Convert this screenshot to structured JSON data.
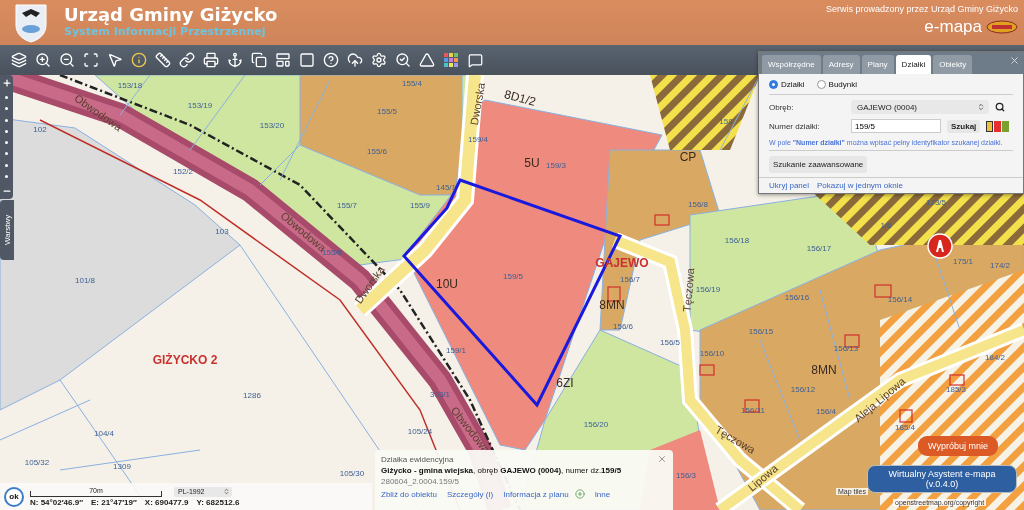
{
  "header": {
    "title": "Urząd Gminy Giżycko",
    "subtitle": "System Informacji Przestrzennej",
    "operator": "Serwis prowadzony przez Urząd Gminy Giżycko",
    "brand": "e-mapa"
  },
  "side_controls": {
    "layers_tab": "Warstwy"
  },
  "search_panel": {
    "tabs": [
      {
        "label": "Współrzędne",
        "selected": false
      },
      {
        "label": "Adresy",
        "selected": false
      },
      {
        "label": "Plany",
        "selected": false
      },
      {
        "label": "Działki",
        "selected": true
      },
      {
        "label": "Obiekty",
        "selected": false
      }
    ],
    "modes": [
      {
        "label": "Działki",
        "selected": true
      },
      {
        "label": "Budynki",
        "selected": false
      }
    ],
    "precinct": {
      "label": "Obręb:",
      "value": "GAJEWO (0004)"
    },
    "parcel_number": {
      "label": "Numer działki:",
      "value": "159/5"
    },
    "search_button": "Szukaj",
    "highlight_colors": [
      {
        "color": "#f0c040",
        "selected": true
      },
      {
        "color": "#e53030",
        "selected": false
      },
      {
        "color": "#7aa030",
        "selected": false
      }
    ],
    "hint": "W pole **\"Numer działki\"** można wpisać pełny identyfikator szukanej działki.",
    "advanced_button": "Szukanie zaawansowane",
    "links": [
      "Ukryj panel",
      "Pokazuj w jednym oknie"
    ]
  },
  "map": {
    "labels": [
      {
        "text": "153/18",
        "kind": "parcel"
      },
      {
        "text": "153/19",
        "kind": "parcel"
      },
      {
        "text": "153/20",
        "kind": "parcel"
      },
      {
        "text": "155/4",
        "kind": "parcel"
      },
      {
        "text": "155/5",
        "kind": "parcel"
      },
      {
        "text": "155/6",
        "kind": "parcel"
      },
      {
        "text": "155/7",
        "kind": "parcel"
      },
      {
        "text": "155/9",
        "kind": "parcel"
      },
      {
        "text": "159/4",
        "kind": "parcel"
      },
      {
        "text": "145/1",
        "kind": "parcel"
      },
      {
        "text": "155/8",
        "kind": "parcel"
      },
      {
        "text": "102",
        "kind": "parcel"
      },
      {
        "text": "152/2",
        "kind": "parcel"
      },
      {
        "text": "103",
        "kind": "parcel"
      },
      {
        "text": "101/8",
        "kind": "parcel"
      },
      {
        "text": "1286",
        "kind": "parcel"
      },
      {
        "text": "104/4",
        "kind": "parcel"
      },
      {
        "text": "105/32",
        "kind": "parcel"
      },
      {
        "text": "1309",
        "kind": "parcel"
      },
      {
        "text": "105/24",
        "kind": "parcel"
      },
      {
        "text": "303/1",
        "kind": "parcel"
      },
      {
        "text": "159/1",
        "kind": "parcel"
      },
      {
        "text": "159/5",
        "kind": "parcel"
      },
      {
        "text": "159/3",
        "kind": "parcel"
      },
      {
        "text": "156/7",
        "kind": "parcel"
      },
      {
        "text": "156/6",
        "kind": "parcel"
      },
      {
        "text": "156/5",
        "kind": "parcel"
      },
      {
        "text": "156/20",
        "kind": "parcel"
      },
      {
        "text": "156/8",
        "kind": "parcel"
      },
      {
        "text": "156/18",
        "kind": "parcel"
      },
      {
        "text": "156/17",
        "kind": "parcel"
      },
      {
        "text": "156/19",
        "kind": "parcel"
      },
      {
        "text": "156/16",
        "kind": "parcel"
      },
      {
        "text": "156/15",
        "kind": "parcel"
      },
      {
        "text": "156/10",
        "kind": "parcel"
      },
      {
        "text": "156/13",
        "kind": "parcel"
      },
      {
        "text": "156/12",
        "kind": "parcel"
      },
      {
        "text": "156/11",
        "kind": "parcel"
      },
      {
        "text": "156/4",
        "kind": "parcel"
      },
      {
        "text": "156/14",
        "kind": "parcel"
      },
      {
        "text": "156/3",
        "kind": "parcel"
      },
      {
        "text": "105/30",
        "kind": "parcel"
      },
      {
        "text": "158",
        "kind": "parcel"
      },
      {
        "text": "173/5",
        "kind": "parcel"
      },
      {
        "text": "1/6",
        "kind": "parcel"
      },
      {
        "text": "175/1",
        "kind": "parcel"
      },
      {
        "text": "174/2",
        "kind": "parcel"
      },
      {
        "text": "184/2",
        "kind": "parcel"
      },
      {
        "text": "185/3",
        "kind": "parcel"
      },
      {
        "text": "185/4",
        "kind": "parcel"
      },
      {
        "text": "5U",
        "kind": "zone"
      },
      {
        "text": "10U",
        "kind": "zone"
      },
      {
        "text": "6ZI",
        "kind": "zone"
      },
      {
        "text": "8MN",
        "kind": "zone"
      },
      {
        "text": "8MN",
        "kind": "zone"
      },
      {
        "text": "8D1/2",
        "kind": "zone"
      },
      {
        "text": "GAJEWO",
        "kind": "place"
      },
      {
        "text": "GIŻYCKO 2",
        "kind": "place"
      },
      {
        "text": "Obwodowa",
        "kind": "street"
      },
      {
        "text": "Obwodowa",
        "kind": "street"
      },
      {
        "text": "Obwodowa",
        "kind": "street"
      },
      {
        "text": "Dworska",
        "kind": "street"
      },
      {
        "text": "Dworska",
        "kind": "street"
      },
      {
        "text": "Tęczowa",
        "kind": "street"
      },
      {
        "text": "Tęczowa",
        "kind": "street"
      },
      {
        "text": "Aleja Lipowa",
        "kind": "street"
      },
      {
        "text": "Lipowa",
        "kind": "street"
      },
      {
        "text": "CP",
        "kind": "zone"
      }
    ]
  },
  "info_popup": {
    "title": "Działka ewidencyjna",
    "description": "**Giżycko - gmina wiejska**, obręb **GAJEWO (0004)**, numer dz.**159/5**",
    "identifier": "280604_2.0004.159/5",
    "links": [
      "Zbliż do obiektu",
      "Szczegóły (I)",
      "Informacja z planu",
      "Inne"
    ]
  },
  "status": {
    "ok_button": "ok",
    "scale": "70m",
    "projection": "PL-1992",
    "coordinates": [
      "N: 54°02′46.9″",
      "E: 21°47′19″",
      "X: 690477.9",
      "Y: 682512.6"
    ]
  },
  "assistant": {
    "tooltip": "Wypróbuj mnie",
    "button": "Wirtualny Asystent e-mapa (v.0.4.0)"
  },
  "attribution": [
    "Map tiles",
    "openstreetmap.org/copyright"
  ]
}
